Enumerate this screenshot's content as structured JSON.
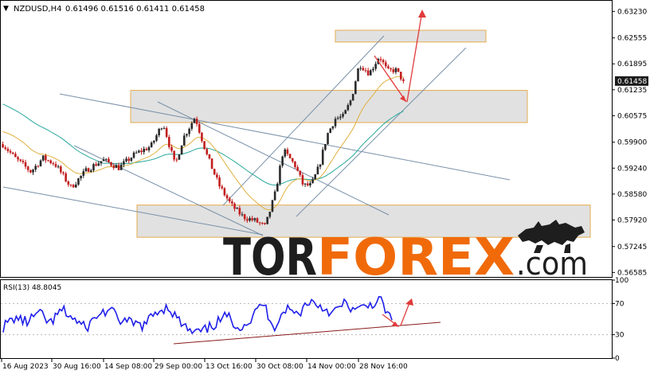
{
  "header": {
    "symbol": "NZDUSD,H4",
    "quote": "0.61496 0.61516 0.61411 0.61458",
    "arrow": "▼"
  },
  "colors": {
    "candle_up": "#2a2a2a",
    "candle_down": "#c21e1e",
    "ma_fast": "#e0b040",
    "ma_slow": "#28a89c",
    "trend_line": "#7890a8",
    "zone_fill": "#dcdcdc",
    "zone_border": "#e6ac4e",
    "arrow": "#e23a3a",
    "rsi_line": "#1f1fe8",
    "rsi_trend": "#8a1a1a",
    "brand_dark": "#1e1e1e",
    "brand_accent": "#f06a0a",
    "price_box": "#1a1a1a"
  },
  "logo": {
    "prefix": "TOR",
    "main": "FOREX",
    "suffix": ".com",
    "icon": "bull-bear-icon"
  },
  "rsi": {
    "label": "RSI(13) 48.8045"
  },
  "current_price_label": "0.61458",
  "chart_data": [
    {
      "type": "candlestick",
      "title": "NZDUSD,H4",
      "ylim": [
        0.5645,
        0.635
      ],
      "y_ticks": [
        "0.63230",
        "0.62555",
        "0.61895",
        "0.61235",
        "0.60575",
        "0.59900",
        "0.59240",
        "0.58580",
        "0.57920",
        "0.57245",
        "0.56585"
      ],
      "y_tick_values": [
        0.6323,
        0.62555,
        0.61895,
        0.61235,
        0.60575,
        0.599,
        0.5924,
        0.5858,
        0.5792,
        0.57245,
        0.56585
      ],
      "x_ticks": [
        "16 Aug 2023",
        "30 Aug 16:00",
        "14 Sep 08:00",
        "29 Sep 00:00",
        "13 Oct 16:00",
        "30 Oct 08:00",
        "14 Nov 00:00",
        "28 Nov 16:00"
      ],
      "current_price": 0.61458,
      "close_anchors": [
        [
          0,
          0.5985
        ],
        [
          0.03,
          0.595
        ],
        [
          0.07,
          0.5915
        ],
        [
          0.1,
          0.595
        ],
        [
          0.13,
          0.5935
        ],
        [
          0.17,
          0.5875
        ],
        [
          0.21,
          0.592
        ],
        [
          0.25,
          0.5945
        ],
        [
          0.29,
          0.5925
        ],
        [
          0.33,
          0.596
        ],
        [
          0.37,
          0.598
        ],
        [
          0.4,
          0.604
        ],
        [
          0.43,
          0.593
        ],
        [
          0.45,
          0.6
        ],
        [
          0.48,
          0.6055
        ],
        [
          0.51,
          0.5955
        ],
        [
          0.54,
          0.588
        ],
        [
          0.57,
          0.583
        ],
        [
          0.6,
          0.58
        ],
        [
          0.63,
          0.579
        ],
        [
          0.655,
          0.5775
        ],
        [
          0.68,
          0.586
        ],
        [
          0.7,
          0.597
        ],
        [
          0.73,
          0.593
        ],
        [
          0.75,
          0.588
        ],
        [
          0.77,
          0.588
        ],
        [
          0.79,
          0.593
        ],
        [
          0.81,
          0.601
        ],
        [
          0.83,
          0.605
        ],
        [
          0.85,
          0.6055
        ],
        [
          0.87,
          0.61
        ],
        [
          0.89,
          0.619
        ],
        [
          0.915,
          0.6165
        ],
        [
          0.94,
          0.621
        ],
        [
          0.96,
          0.617
        ],
        [
          0.98,
          0.6175
        ],
        [
          1.0,
          0.61458
        ]
      ],
      "zones": [
        {
          "from": 0.6245,
          "to": 0.6275,
          "x_start": "28 Nov 16:00"
        },
        {
          "from": 0.604,
          "to": 0.6122,
          "x_start": "29 Sep 00:00"
        },
        {
          "from": 0.5748,
          "to": 0.583,
          "x_start": "29 Sep 00:00"
        }
      ],
      "moving_averages": [
        "fast",
        "slow"
      ],
      "forecast": "bounce from 0.6122 support toward 0.6320"
    },
    {
      "type": "line",
      "title": "RSI(13) 48.8045",
      "ylim": [
        0,
        100
      ],
      "y_ticks": [
        "100",
        "70",
        "30",
        "0"
      ],
      "y_tick_values": [
        100,
        70,
        30,
        0
      ],
      "current_value": 48.8045,
      "series": [
        {
          "values": [
            40,
            52,
            46,
            58,
            44,
            62,
            50,
            38,
            55,
            62,
            48,
            44,
            42,
            60,
            66,
            46,
            32,
            34,
            44,
            54,
            40,
            48,
            72,
            40,
            64,
            56,
            74,
            66,
            58,
            70,
            60,
            68,
            74,
            48
          ]
        }
      ]
    }
  ]
}
